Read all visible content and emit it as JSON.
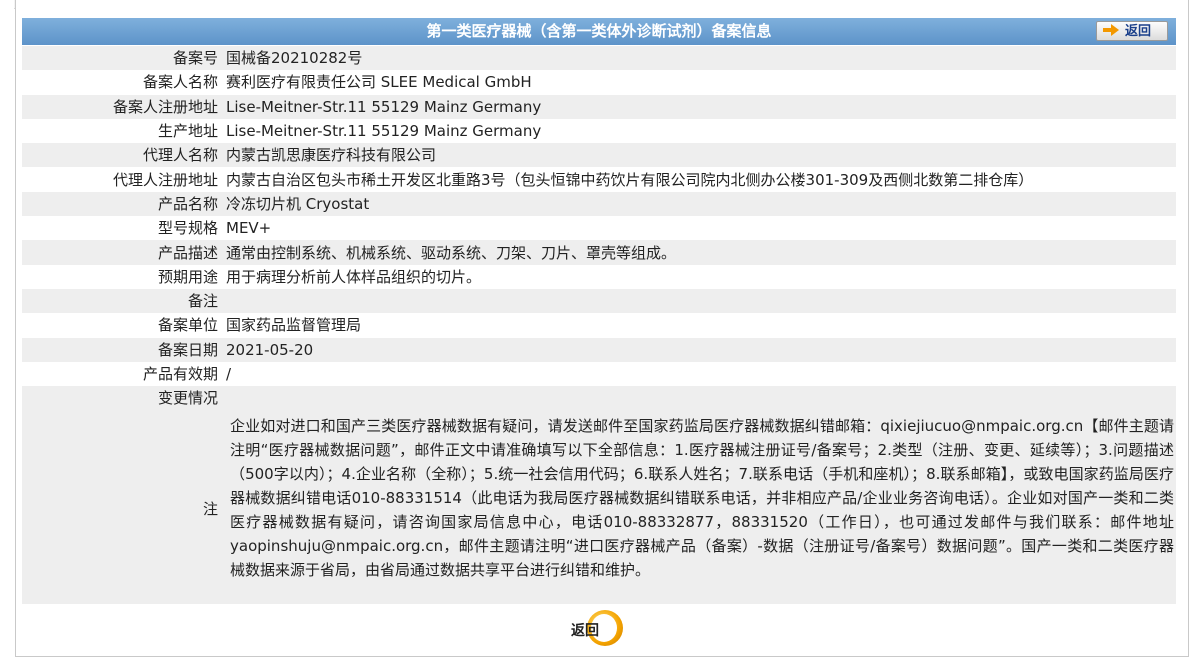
{
  "header": {
    "title": "第一类医疗器械（含第一类体外诊断试剂）备案信息",
    "back_label": "返回"
  },
  "rows": [
    {
      "label": "备案号",
      "value": "国械备20210282号"
    },
    {
      "label": "备案人名称",
      "value": "赛利医疗有限责任公司 SLEE Medical GmbH"
    },
    {
      "label": "备案人注册地址",
      "value": "Lise-Meitner-Str.11 55129 Mainz Germany"
    },
    {
      "label": "生产地址",
      "value": "Lise-Meitner-Str.11 55129 Mainz Germany"
    },
    {
      "label": "代理人名称",
      "value": "内蒙古凯思康医疗科技有限公司"
    },
    {
      "label": "代理人注册地址",
      "value": "内蒙古自治区包头市稀土开发区北重路3号（包头恒锦中药饮片有限公司院内北侧办公楼301-309及西侧北数第二排仓库）"
    },
    {
      "label": "产品名称",
      "value": "冷冻切片机 Cryostat"
    },
    {
      "label": "型号规格",
      "value": "MEV+"
    },
    {
      "label": "产品描述",
      "value": "通常由控制系统、机械系统、驱动系统、刀架、刀片、罩壳等组成。"
    },
    {
      "label": "预期用途",
      "value": "用于病理分析前人体样品组织的切片。"
    },
    {
      "label": "备注",
      "value": ""
    },
    {
      "label": "备案单位",
      "value": "国家药品监督管理局"
    },
    {
      "label": "备案日期",
      "value": "2021-05-20"
    },
    {
      "label": "产品有效期",
      "value": "/"
    },
    {
      "label": "变更情况",
      "value": ""
    }
  ],
  "note": {
    "label": "注",
    "text": "企业如对进口和国产三类医疗器械数据有疑问，请发送邮件至国家药监局医疗器械数据纠错邮箱：qixiejiucuo@nmpaic.org.cn【邮件主题请注明“医疗器械数据问题”，邮件正文中请准确填写以下全部信息：1.医疗器械注册证号/备案号；2.类型（注册、变更、延续等）；3.问题描述（500字以内）；4.企业名称（全称）；5.统一社会信用代码；6.联系人姓名；7.联系电话（手机和座机）；8.联系邮箱】，或致电国家药监局医疗器械数据纠错电话010-88331514（此电话为我局医疗器械数据纠错联系电话，并非相应产品/企业业务咨询电话）。企业如对国产一类和二类医疗器械数据有疑问，请咨询国家局信息中心，电话010-88332877，88331520（工作日），也可通过发邮件与我们联系：邮件地址yaopinshuju@nmpaic.org.cn，邮件主题请注明“进口医疗器械产品（备案）-数据（注册证号/备案号）数据问题”。国产一类和二类医疗器械数据来源于省局，由省局通过数据共享平台进行纠错和维护。"
  },
  "footer": {
    "back_label": "返回"
  },
  "colors": {
    "header_bg": "#6fa3d5",
    "row_alt_bg": "#eeeeee",
    "back_accent": "#f4a300"
  }
}
